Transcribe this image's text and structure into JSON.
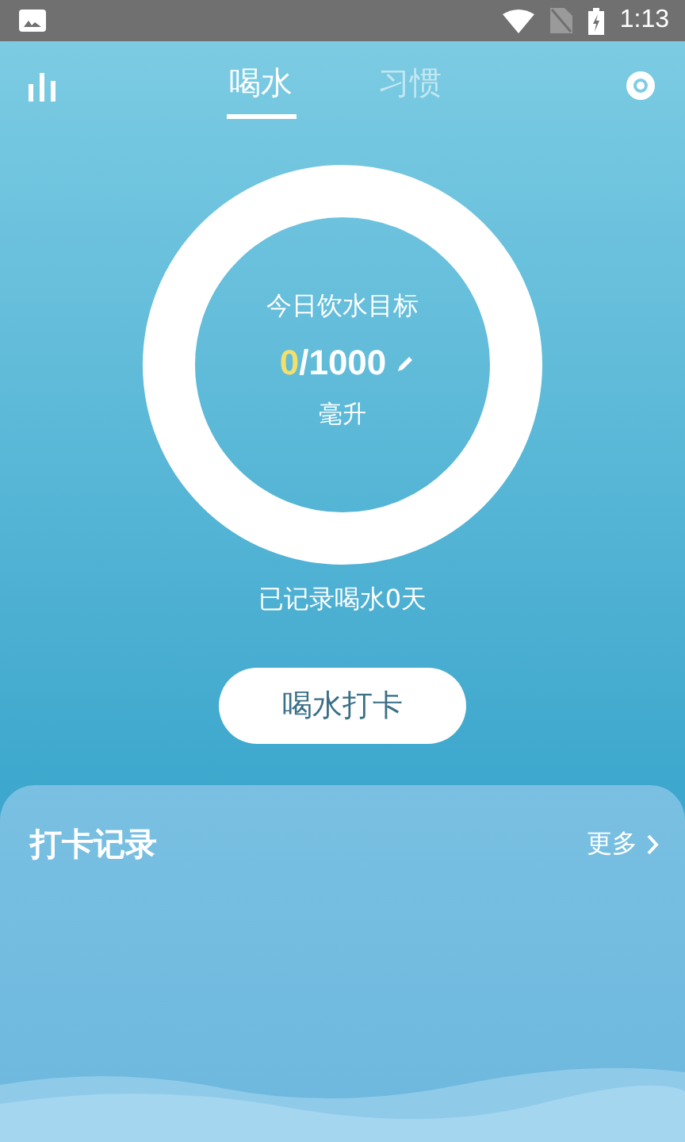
{
  "status_bar": {
    "time": "1:13"
  },
  "tabs": [
    {
      "label": "喝水",
      "selected": true
    },
    {
      "label": "习惯",
      "selected": false
    }
  ],
  "goal": {
    "title": "今日饮水目标",
    "current": "0",
    "target": "/1000",
    "unit": "毫升"
  },
  "streak": "已记录喝水0天",
  "checkin_button": "喝水打卡",
  "records": {
    "title": "打卡记录",
    "more": "更多"
  }
}
